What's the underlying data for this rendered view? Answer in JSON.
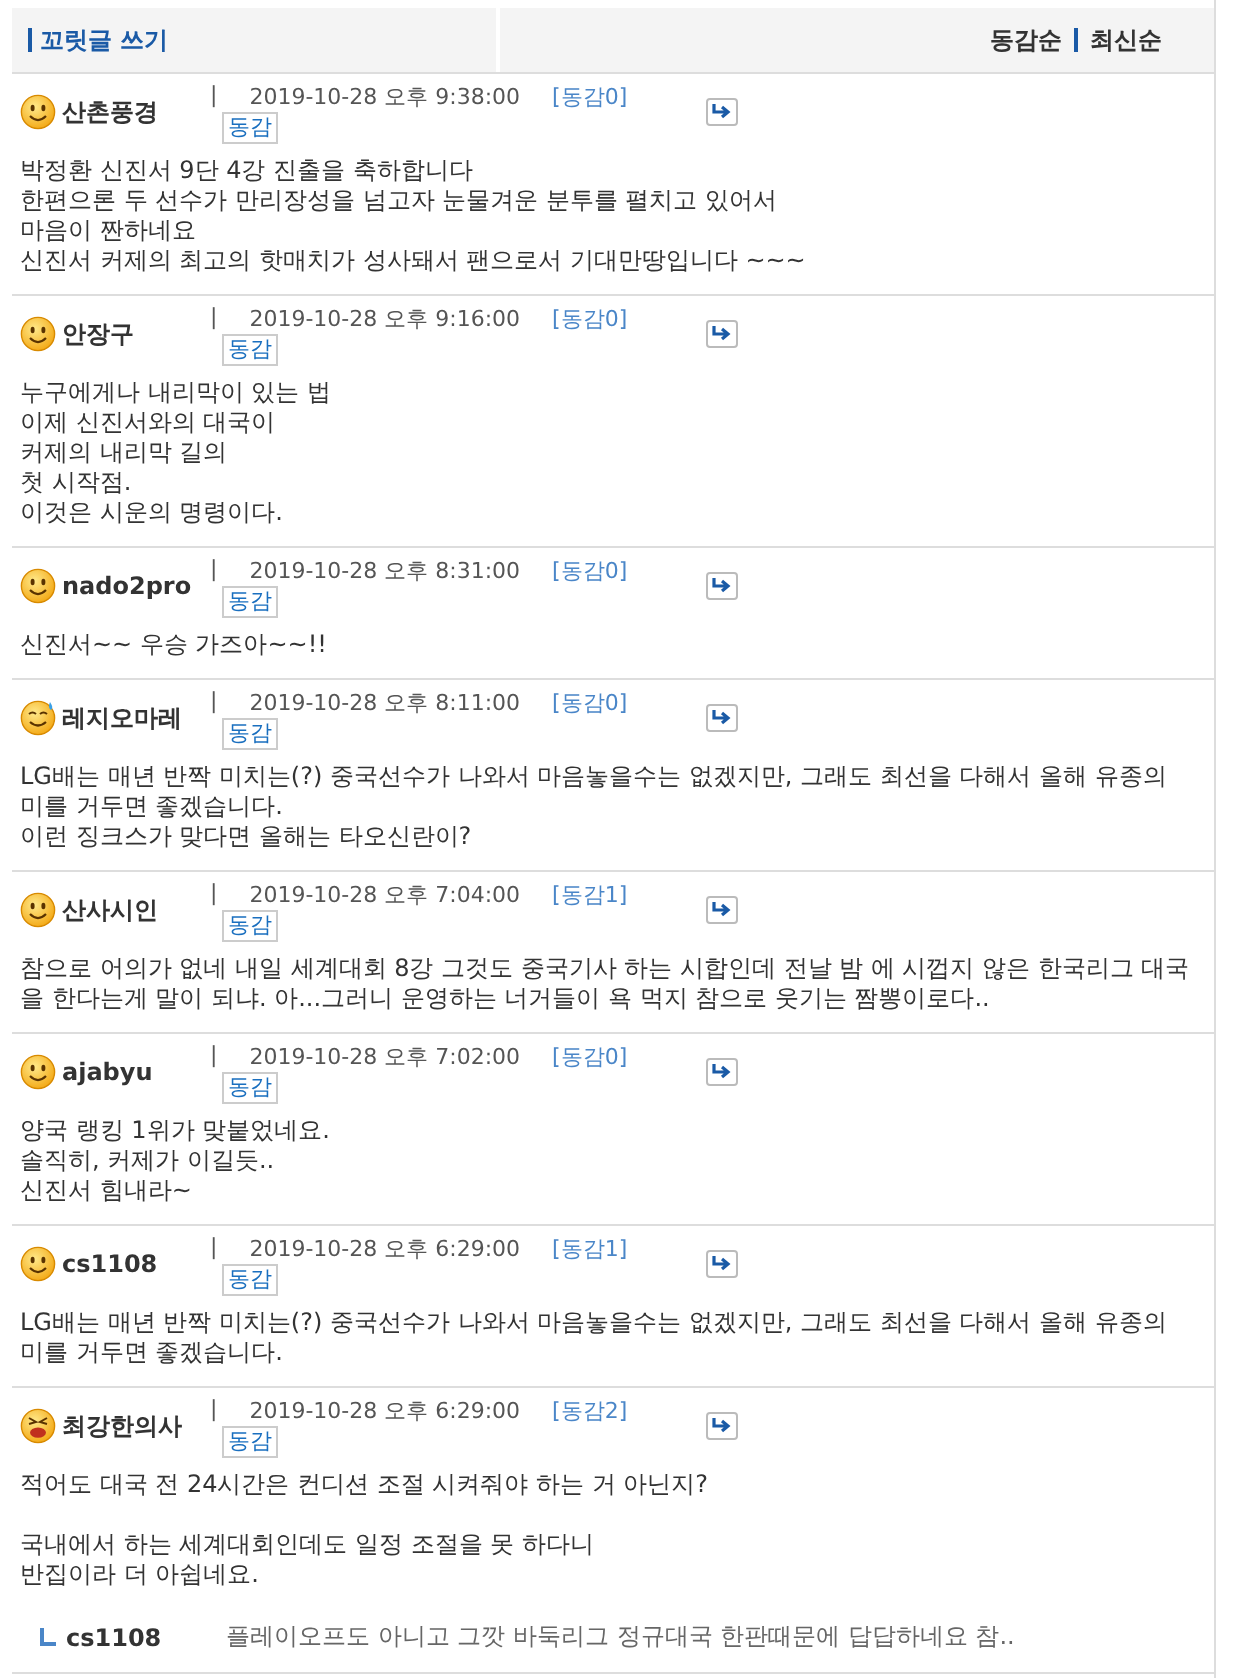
{
  "header": {
    "write_link": "꼬릿글 쓰기",
    "sort_options": [
      {
        "label": "동감순",
        "selected": false
      },
      {
        "label": "최신순",
        "selected": false
      }
    ]
  },
  "comments": [
    {
      "author": "산촌풍경",
      "kind": "smile",
      "separator": "|",
      "date": "2019-10-28 오후 9:38:00",
      "likes": "[동감0]",
      "like_button": "동감",
      "paragraphs": [
        [
          "박정환 신진서 9단 4강 진출을 축하합니다",
          "한편으론 두 선수가 만리장성을 넘고자 눈물겨운 분투를 펼치고 있어서",
          "마음이 짠하네요",
          "신진서 커제의 최고의 핫매치가 성사돼서 팬으로서 기대만땅입니다 ~~~"
        ]
      ]
    },
    {
      "author": "안장구",
      "kind": "smile",
      "separator": "|",
      "date": "2019-10-28 오후 9:16:00",
      "likes": "[동감0]",
      "like_button": "동감",
      "paragraphs": [
        [
          "누구에게나 내리막이 있는 법",
          "이제 신진서와의 대국이",
          "커제의 내리막 길의",
          "첫 시작점.",
          "이것은 시운의 명령이다."
        ]
      ]
    },
    {
      "author": "nado2pro",
      "kind": "smile",
      "separator": "|",
      "date": "2019-10-28 오후 8:31:00",
      "likes": "[동감0]",
      "like_button": "동감",
      "paragraphs": [
        [
          "신진서~~ 우승 가즈아~~!!"
        ]
      ]
    },
    {
      "author": "레지오마레",
      "kind": "sweat",
      "separator": "|",
      "date": "2019-10-28 오후 8:11:00",
      "likes": "[동감0]",
      "like_button": "동감",
      "paragraphs": [
        [
          "LG배는 매년 반짝 미치는(?) 중국선수가 나와서 마음놓을수는 없겠지만, 그래도 최선을 다해서 올해 유종의",
          "미를 거두면 좋겠습니다.",
          "이런 징크스가 맞다면 올해는 타오신란이?"
        ]
      ]
    },
    {
      "author": "산사시인",
      "kind": "smile",
      "separator": "|",
      "date": "2019-10-28 오후 7:04:00",
      "likes": "[동감1]",
      "like_button": "동감",
      "paragraphs": [
        [
          "참으로 어의가 없네 내일 세계대회 8강 그것도 중국기사 하는 시합인데 전날 밤 에 시껍지 않은 한국리그 대국",
          "을 한다는게 말이 되냐. 아...그러니 운영하는 너거들이 욕 먹지 참으로 웃기는 짬뽕이로다.."
        ]
      ]
    },
    {
      "author": "ajabyu",
      "kind": "smile",
      "separator": "|",
      "date": "2019-10-28 오후 7:02:00",
      "likes": "[동감0]",
      "like_button": "동감",
      "paragraphs": [
        [
          "양국 랭킹 1위가 맞붙었네요.",
          "솔직히, 커제가 이길듯..",
          "신진서 힘내라~"
        ]
      ]
    },
    {
      "author": "cs1108",
      "kind": "smile",
      "separator": "|",
      "date": "2019-10-28 오후 6:29:00",
      "likes": "[동감1]",
      "like_button": "동감",
      "paragraphs": [
        [
          "LG배는 매년 반짝 미치는(?) 중국선수가 나와서 마음놓을수는 없겠지만, 그래도 최선을 다해서 올해 유종의",
          "미를 거두면 좋겠습니다."
        ]
      ]
    },
    {
      "author": "최강한의사",
      "kind": "angry",
      "separator": "|",
      "date": "2019-10-28 오후 6:29:00",
      "likes": "[동감2]",
      "like_button": "동감",
      "paragraphs": [
        [
          "적어도 대국 전 24시간은 컨디션 조절 시켜줘야 하는 거 아닌지?"
        ],
        [
          "국내에서 하는 세계대회인데도 일정 조절을 못 하다니",
          "반집이라 더 아쉽네요."
        ]
      ],
      "replies": [
        {
          "author": "cs1108",
          "text": "플레이오프도 아니고 그깟 바둑리그 정규대국 한판때문에 답답하네요 참.."
        }
      ]
    }
  ]
}
